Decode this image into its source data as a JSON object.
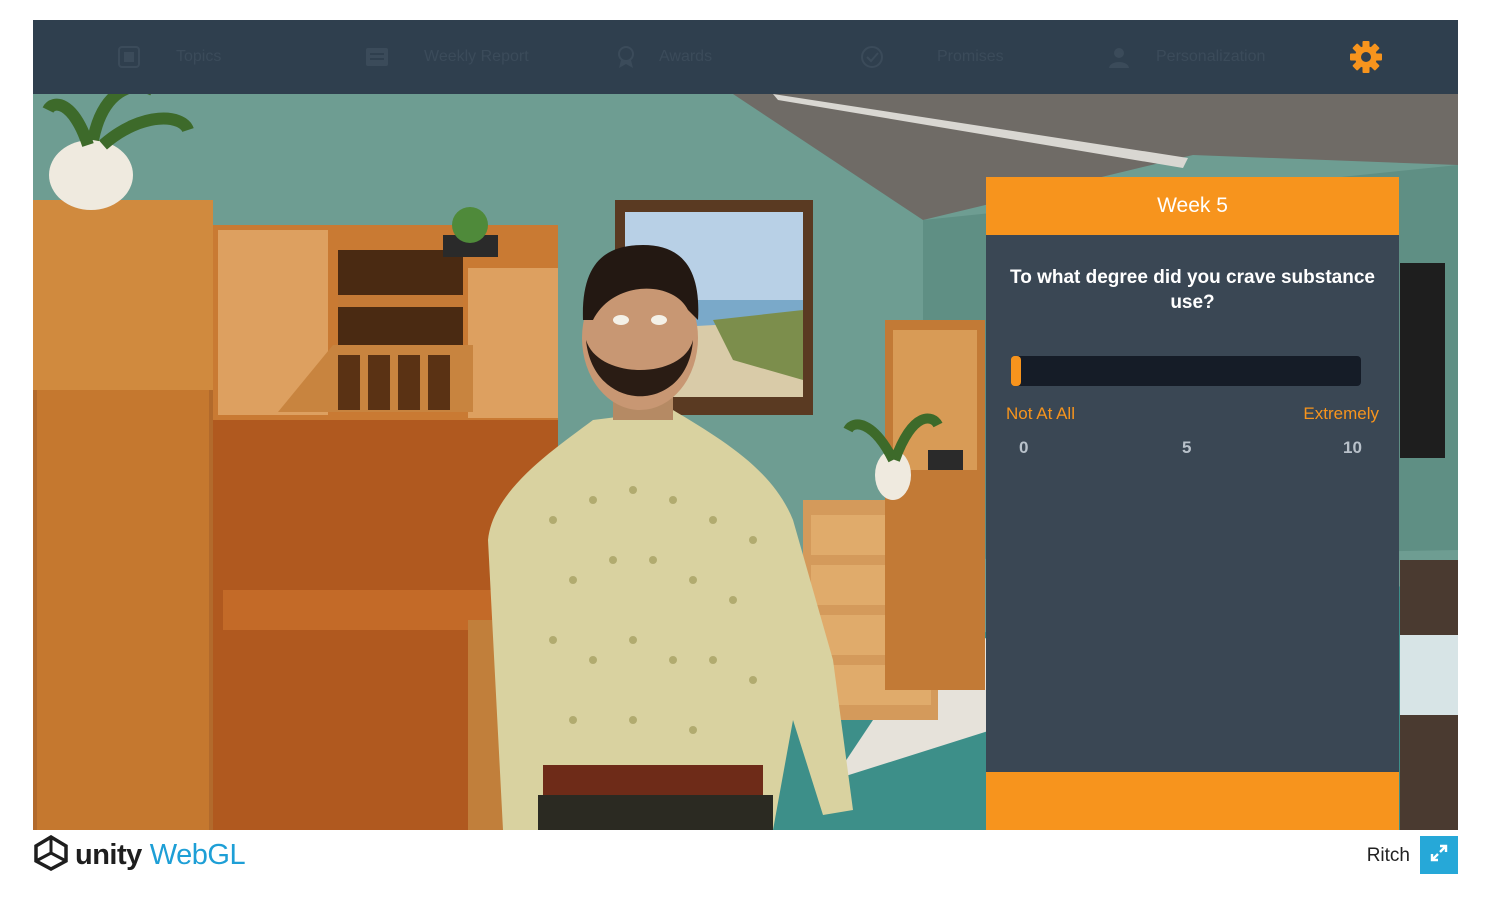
{
  "nav": {
    "items": [
      {
        "label": "Topics",
        "icon": "topics-icon"
      },
      {
        "label": "Weekly Report",
        "icon": "report-icon"
      },
      {
        "label": "Awards",
        "icon": "awards-icon"
      },
      {
        "label": "Promises",
        "icon": "promises-icon"
      },
      {
        "label": "Personalization",
        "icon": "personalization-icon"
      }
    ],
    "settings_icon": "gear-icon"
  },
  "survey": {
    "title": "Week 5",
    "question": "To what degree did you crave substance use?",
    "min_label": "Not At All",
    "max_label": "Extremely",
    "ticks": [
      "0",
      "5",
      "10"
    ],
    "value": 0,
    "max_value": 10
  },
  "footer": {
    "engine_word": "unity",
    "platform_word": "WebGL",
    "build_title": "Ritch",
    "fullscreen_icon": "fullscreen-icon"
  },
  "colors": {
    "accent": "#f7941d",
    "nav_bg": "#2f3f4e",
    "panel_bg": "#3a4754",
    "track_bg": "#151c27",
    "fullscreen_bg": "#26a8d8"
  }
}
